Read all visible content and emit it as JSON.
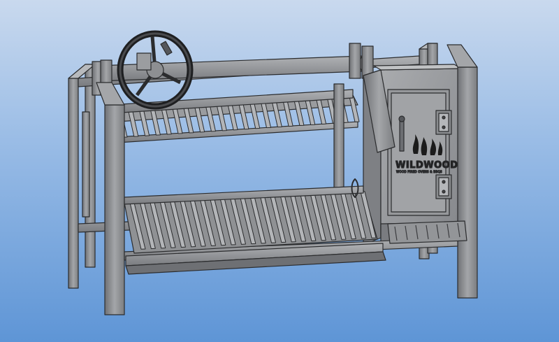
{
  "brand": {
    "name": "WILDWOOD",
    "tagline": "WOOD FIRED OVENS & BBQS"
  },
  "colors": {
    "steel": "#8a8c8f",
    "steel_light": "#b5b7ba",
    "steel_dark": "#4e5054",
    "edge": "#2b2c2e",
    "wheel": "#3a3b3d",
    "sky_top": "#c9d9ee",
    "sky_bottom": "#5e95d6"
  },
  "icons": [
    "hand-wheel-icon",
    "door-hinge-icon",
    "door-handle-icon",
    "carabiner-icon"
  ],
  "grates": {
    "upper_bars": 22,
    "lower_bars": 24
  }
}
